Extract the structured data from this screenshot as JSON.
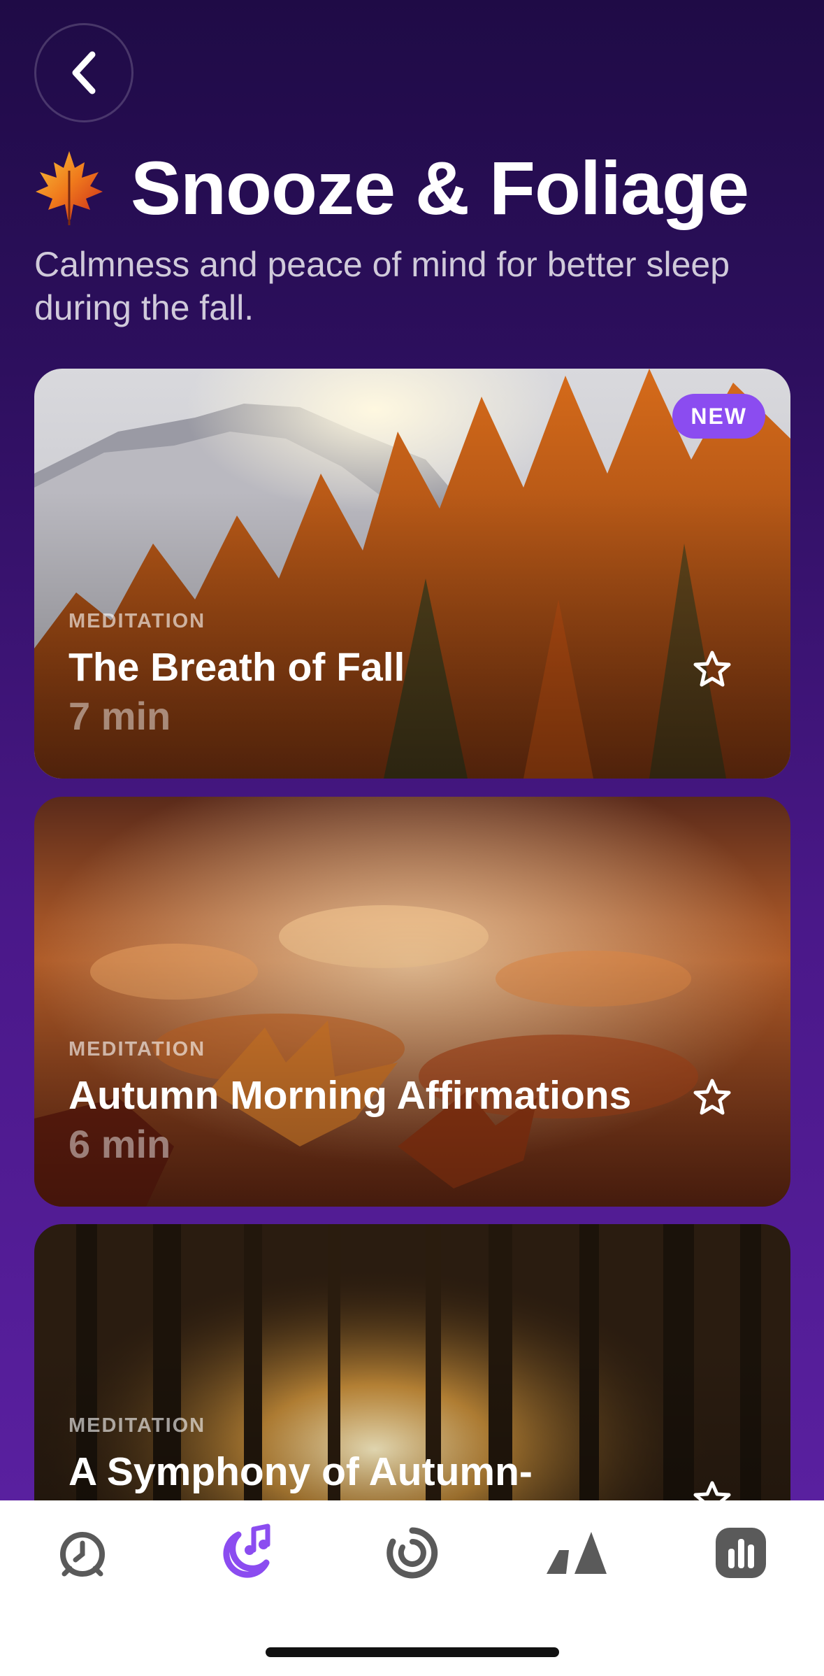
{
  "header": {
    "title": "Snooze & Foliage",
    "subtitle": "Calmness and peace of mind for better sleep during the fall."
  },
  "cards": [
    {
      "kind": "MEDITATION",
      "name": "The Breath of Fall",
      "duration": "7 min",
      "badge": "NEW"
    },
    {
      "kind": "MEDITATION",
      "name": "Autumn Morning Affirmations",
      "duration": "6 min"
    },
    {
      "kind": "MEDITATION",
      "name": "A Symphony of Autumn-",
      "duration": ""
    }
  ],
  "tabbar": {
    "active_color": "#8b4cf0",
    "inactive_color": "#5a5a5a",
    "tabs": [
      "alarm-clock-icon",
      "moon-sound-icon",
      "progress-ring-icon",
      "mountains-icon",
      "stats-icon"
    ],
    "active_index": 1
  },
  "colors": {
    "background_top": "#1f0b46",
    "background_bottom": "#5e22a6",
    "badge": "#8b4cf0"
  }
}
